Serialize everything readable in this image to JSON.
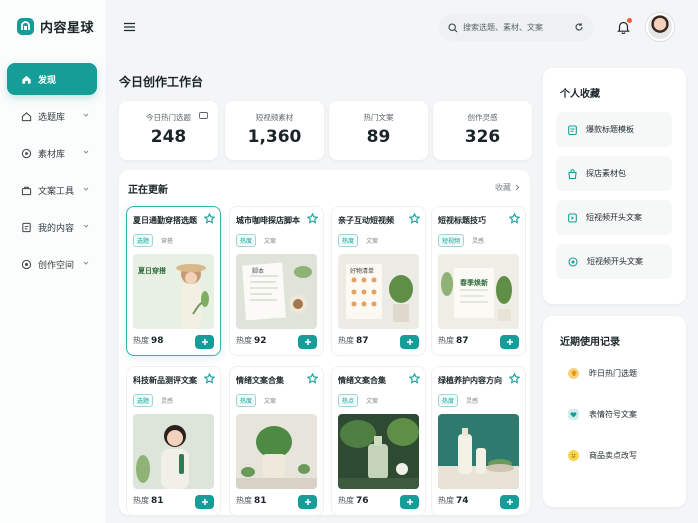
{
  "brand": {
    "name": "内容星球"
  },
  "sidebar": {
    "items": [
      {
        "label": "发现",
        "icon": "home-icon",
        "active": true
      },
      {
        "label": "选题库",
        "icon": "lightbulb-icon"
      },
      {
        "label": "素材库",
        "icon": "folder-icon"
      },
      {
        "label": "文案工具",
        "icon": "briefcase-icon"
      },
      {
        "label": "我的内容",
        "icon": "document-icon"
      },
      {
        "label": "创作空间",
        "icon": "target-icon"
      }
    ]
  },
  "header": {
    "search_placeholder": "搜索选题、素材、文案"
  },
  "main": {
    "title": "今日创作工作台",
    "stats": [
      {
        "label": "今日热门选题",
        "value": "248"
      },
      {
        "label": "短视频素材",
        "value": "1,360"
      },
      {
        "label": "热门文案",
        "value": "89"
      },
      {
        "label": "创作灵感",
        "value": "326"
      }
    ],
    "updates": {
      "title": "正在更新",
      "more_label": "收藏",
      "heat_label": "热度",
      "cards": [
        {
          "title": "夏日通勤穿搭选题",
          "tags": [
            "选题",
            "穿搭"
          ],
          "heat": "98",
          "thumb_text": "夏日穿搭"
        },
        {
          "title": "城市咖啡探店脚本",
          "tags": [
            "热度",
            "文案"
          ],
          "heat": "92",
          "thumb_text": "脚本"
        },
        {
          "title": "亲子互动短视频",
          "tags": [
            "热度",
            "文案"
          ],
          "heat": "87",
          "thumb_text": "好物清单"
        },
        {
          "title": "短视标题技巧",
          "tags": [
            "短视频",
            "灵感"
          ],
          "heat": "87",
          "thumb_text": "春季焕新"
        },
        {
          "title": "科技新品测评文案",
          "tags": [
            "选题",
            "灵感"
          ],
          "heat": "81",
          "thumb_text": ""
        },
        {
          "title": "情绪文案合集",
          "tags": [
            "热度",
            "文案"
          ],
          "heat": "81",
          "thumb_text": ""
        },
        {
          "title": "情绪文案合集",
          "tags": [
            "热点",
            "文案"
          ],
          "heat": "76",
          "thumb_text": ""
        },
        {
          "title": "绿植养护内容方向",
          "tags": [
            "热度",
            "灵感"
          ],
          "heat": "74",
          "thumb_text": ""
        }
      ]
    }
  },
  "favorites": {
    "title": "个人收藏",
    "items": [
      {
        "label": "爆款标题模板",
        "icon": "clipboard-icon"
      },
      {
        "label": "探店素材包",
        "icon": "bag-icon"
      },
      {
        "label": "短视频开头文案",
        "icon": "play-icon"
      },
      {
        "label": "短视频开头文案",
        "icon": "target-icon"
      }
    ]
  },
  "recent": {
    "title": "近期使用记录",
    "items": [
      {
        "label": "昨日热门选题",
        "icon": "bulb-icon",
        "color": "#f2b233"
      },
      {
        "label": "表情符号文案",
        "icon": "heart-icon",
        "color": "#169d98"
      },
      {
        "label": "商品卖点改写",
        "icon": "smile-icon",
        "color": "#f2c230"
      }
    ]
  },
  "colors": {
    "accent": "#169d98",
    "notification": "#f25b3c"
  }
}
